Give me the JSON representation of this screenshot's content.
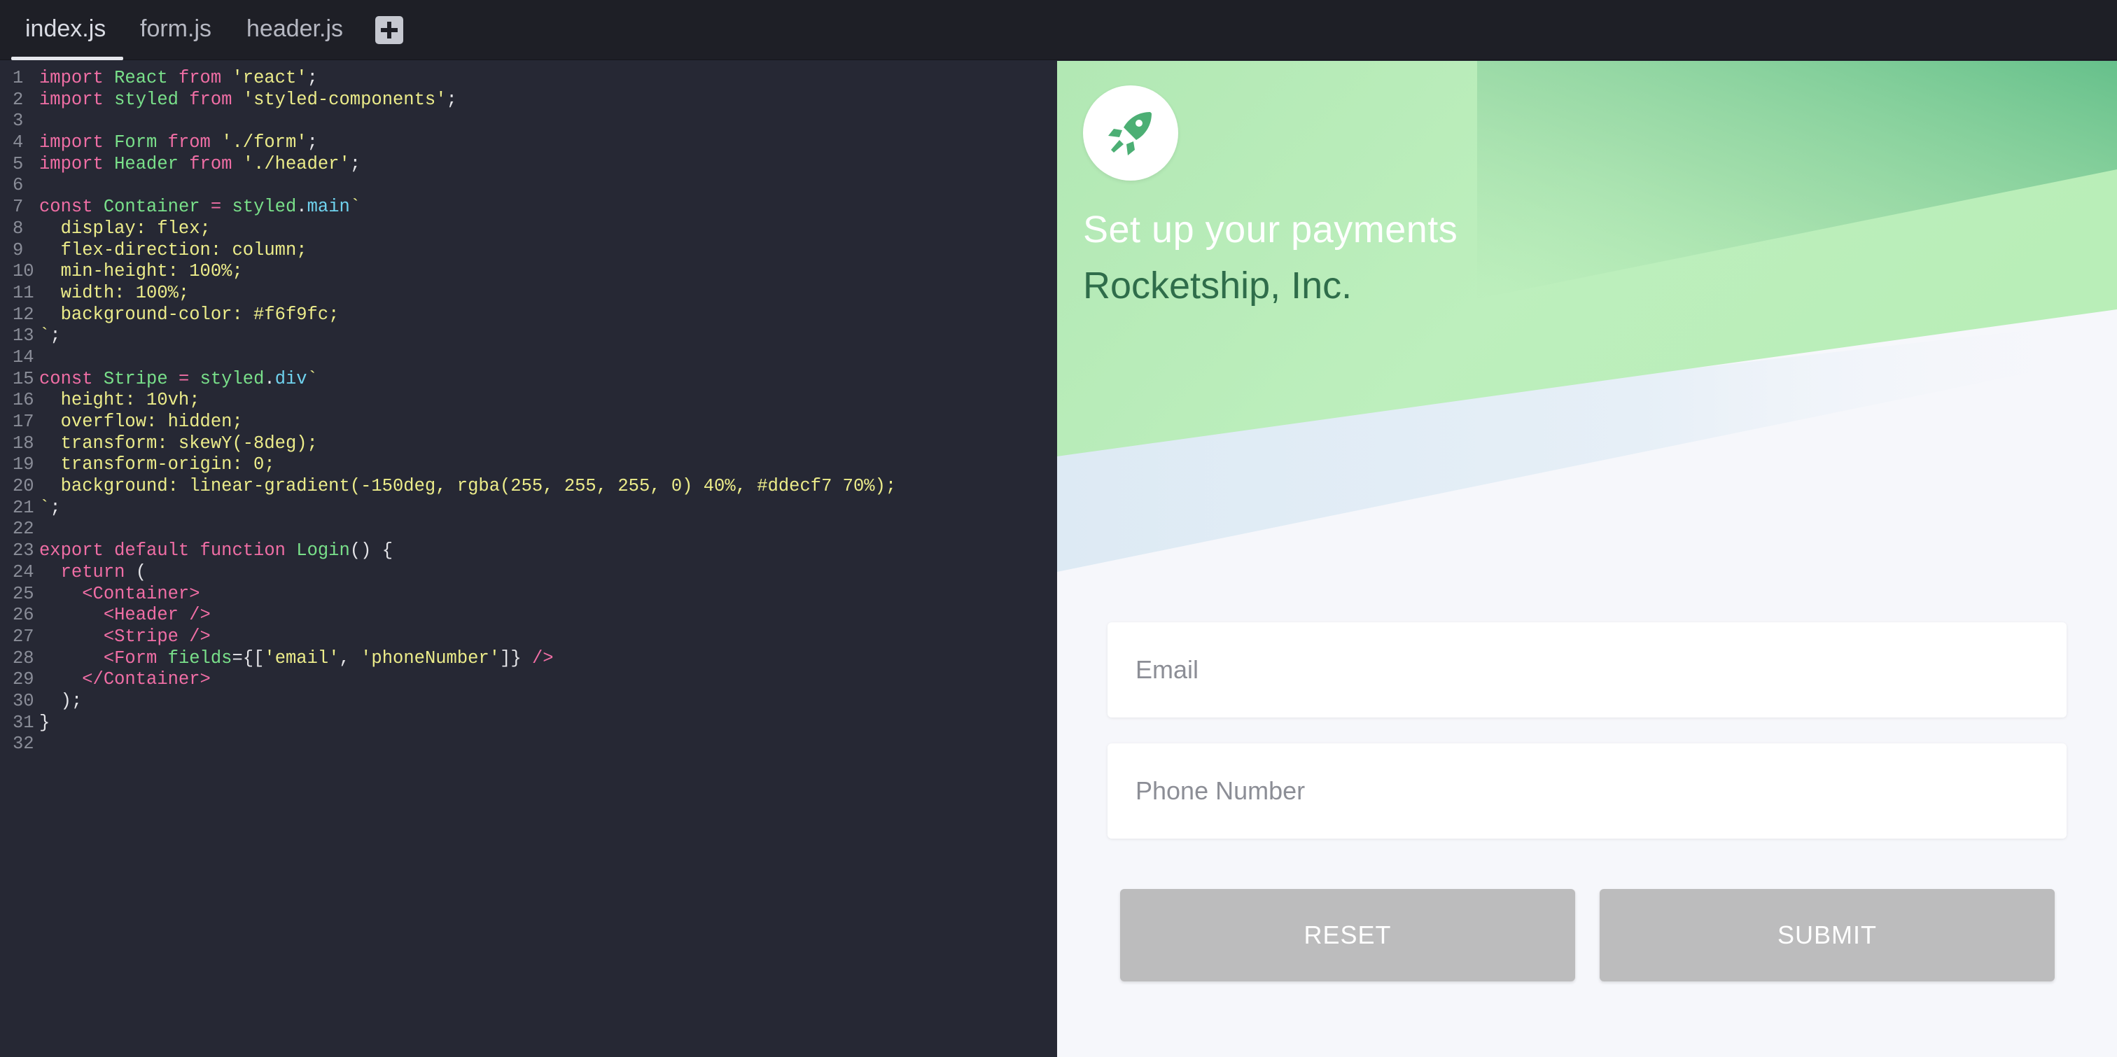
{
  "tabs": [
    {
      "label": "index.js",
      "active": true
    },
    {
      "label": "form.js",
      "active": false
    },
    {
      "label": "header.js",
      "active": false
    }
  ],
  "add_tab_icon": "plus-icon",
  "code_lines": [
    [
      [
        "kw",
        "import "
      ],
      [
        "id",
        "React "
      ],
      [
        "kw",
        "from "
      ],
      [
        "str",
        "'react'"
      ],
      [
        "pl",
        ";"
      ]
    ],
    [
      [
        "kw",
        "import "
      ],
      [
        "id",
        "styled "
      ],
      [
        "kw",
        "from "
      ],
      [
        "str",
        "'styled-components'"
      ],
      [
        "pl",
        ";"
      ]
    ],
    [],
    [
      [
        "kw",
        "import "
      ],
      [
        "id",
        "Form "
      ],
      [
        "kw",
        "from "
      ],
      [
        "str",
        "'./form'"
      ],
      [
        "pl",
        ";"
      ]
    ],
    [
      [
        "kw",
        "import "
      ],
      [
        "id",
        "Header "
      ],
      [
        "kw",
        "from "
      ],
      [
        "str",
        "'./header'"
      ],
      [
        "pl",
        ";"
      ]
    ],
    [],
    [
      [
        "kw",
        "const "
      ],
      [
        "id",
        "Container "
      ],
      [
        "kw",
        "= "
      ],
      [
        "id",
        "styled"
      ],
      [
        "pl",
        "."
      ],
      [
        "prop",
        "main"
      ],
      [
        "str",
        "`"
      ]
    ],
    [
      [
        "css",
        "  display: flex;"
      ]
    ],
    [
      [
        "css",
        "  flex-direction: column;"
      ]
    ],
    [
      [
        "css",
        "  min-height: 100%;"
      ]
    ],
    [
      [
        "css",
        "  width: 100%;"
      ]
    ],
    [
      [
        "css",
        "  background-color: #f6f9fc;"
      ]
    ],
    [
      [
        "str",
        "`"
      ],
      [
        "pl",
        ";"
      ]
    ],
    [],
    [
      [
        "kw",
        "const "
      ],
      [
        "id",
        "Stripe "
      ],
      [
        "kw",
        "= "
      ],
      [
        "id",
        "styled"
      ],
      [
        "pl",
        "."
      ],
      [
        "prop",
        "div"
      ],
      [
        "str",
        "`"
      ]
    ],
    [
      [
        "css",
        "  height: 10vh;"
      ]
    ],
    [
      [
        "css",
        "  overflow: hidden;"
      ]
    ],
    [
      [
        "css",
        "  transform: skewY(-8deg);"
      ]
    ],
    [
      [
        "css",
        "  transform-origin: 0;"
      ]
    ],
    [
      [
        "css",
        "  background: linear-gradient(-150deg, rgba(255, 255, 255, 0) 40%, #ddecf7 70%);"
      ]
    ],
    [
      [
        "str",
        "`"
      ],
      [
        "pl",
        ";"
      ]
    ],
    [],
    [
      [
        "kw",
        "export default function "
      ],
      [
        "id",
        "Login"
      ],
      [
        "pl",
        "() {"
      ]
    ],
    [
      [
        "kw",
        "  return "
      ],
      [
        "pl",
        "("
      ]
    ],
    [
      [
        "tag",
        "    <Container>"
      ]
    ],
    [
      [
        "tag",
        "      <Header />"
      ]
    ],
    [
      [
        "tag",
        "      <Stripe />"
      ]
    ],
    [
      [
        "tag",
        "      <Form "
      ],
      [
        "id",
        "fields"
      ],
      [
        "pl",
        "={["
      ],
      [
        "str",
        "'email'"
      ],
      [
        "pl",
        ", "
      ],
      [
        "str",
        "'phoneNumber'"
      ],
      [
        "pl",
        "]} "
      ],
      [
        "tag",
        "/>"
      ]
    ],
    [
      [
        "tag",
        "    </Container>"
      ]
    ],
    [
      [
        "pl",
        "  );"
      ]
    ],
    [
      [
        "pl",
        "}"
      ]
    ],
    []
  ],
  "preview": {
    "logo_icon": "rocket-icon",
    "title": "Set up your payments",
    "company": "Rocketship, Inc.",
    "email_placeholder": "Email",
    "phone_placeholder": "Phone Number",
    "reset_label": "RESET",
    "submit_label": "SUBMIT",
    "colors": {
      "background": "#f6f7fb",
      "stripe_green": "#bdeebc",
      "stripe_dark_green": "#6fc48f",
      "stripe_blue": "#ddecf7",
      "button": "#bcbcbd",
      "rocket": "#4caf74"
    }
  }
}
